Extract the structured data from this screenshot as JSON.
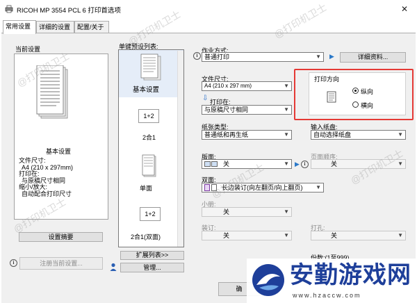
{
  "window": {
    "title": "RICOH MP 3554 PCL 6 打印首选项",
    "close": "✕"
  },
  "tabs": [
    {
      "label": "常用设置"
    },
    {
      "label": "详细的设置"
    },
    {
      "label": "配置/关于"
    }
  ],
  "current_settings": {
    "heading": "当前设置",
    "name": "基本设置",
    "details": [
      "文件尺寸:",
      "A4 (210 x 297mm)",
      "打印在:",
      "与原稿尺寸相同",
      "缩小/放大:",
      "自动配合打印尺寸"
    ],
    "summary_button": "设置摘要",
    "register_button": "注册当前设置..."
  },
  "presets": {
    "heading": "单键预设列表:",
    "items": [
      {
        "label": "基本设置",
        "icon_text": ""
      },
      {
        "label": "2合1",
        "icon_text": "1+2"
      },
      {
        "label": "单面",
        "icon_text": ""
      },
      {
        "label": "2合1(双面)",
        "icon_text": "1+2"
      }
    ],
    "expand_button": "扩展列表>>",
    "manage_button": "管理..."
  },
  "job": {
    "label": "作业方式:",
    "value": "普通打印",
    "details_button": "详细资料..."
  },
  "document_size": {
    "label": "文件尺寸:",
    "value": "A4 (210 x 297 mm)"
  },
  "print_on": {
    "label": "打印在:",
    "value": "与原稿尺寸相同"
  },
  "orientation": {
    "title": "打印方向",
    "options": [
      {
        "label": "纵向",
        "checked": true
      },
      {
        "label": "横向",
        "checked": false
      }
    ]
  },
  "paper_type": {
    "label": "纸张类型:",
    "value": "普通纸和再生纸"
  },
  "input_tray": {
    "label": "输入纸盘:",
    "value": "自动选择纸盘"
  },
  "layout": {
    "label": "版面:",
    "value": "关"
  },
  "page_order": {
    "label": "页面顺序:",
    "value": "关"
  },
  "duplex": {
    "label": "双面:",
    "value": "长边装订(向左翻页/向上翻页)"
  },
  "booklet": {
    "label": "小册:",
    "value": "关"
  },
  "staple": {
    "label": "装订:",
    "value": "关"
  },
  "punch": {
    "label": "打孔:",
    "value": "关"
  },
  "copies": {
    "label": "份数:(1至999)"
  },
  "ok_button": "确",
  "watermarks": [
    "@打印机卫士",
    "@打印机卫士",
    "@打印机卫士",
    "@打印机卫士",
    "@打印机卫士",
    "@打印机卫士"
  ],
  "logo": {
    "text": "安勤游戏网",
    "url": "www.hzaccw.com"
  },
  "colors": {
    "accent": "#1e3f9a",
    "highlight": "#e53935",
    "panel": "#f0f0f0"
  }
}
